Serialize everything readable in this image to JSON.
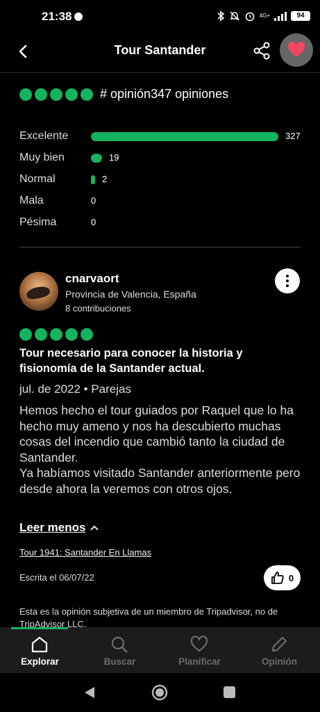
{
  "status_bar": {
    "time": "21:38",
    "network": "4G+",
    "battery": "94"
  },
  "header": {
    "title": "Tour Santander"
  },
  "summary": {
    "rating_bubbles": 5,
    "text": "# opinión347 opiniones"
  },
  "distribution": [
    {
      "label": "Excelente",
      "count": "327",
      "fraction": 1.0
    },
    {
      "label": "Muy bien",
      "count": "19",
      "fraction": 0.058
    },
    {
      "label": "Normal",
      "count": "2",
      "fraction": 0.006
    },
    {
      "label": "Mala",
      "count": "0",
      "fraction": 0
    },
    {
      "label": "Pésima",
      "count": "0",
      "fraction": 0
    }
  ],
  "review": {
    "username": "cnarvaort",
    "location": "Provincia de Valencia, España",
    "contributions": "8 contribuciones",
    "rating_bubbles": 5,
    "title": "Tour necesario para conocer la historia y fisionomía de la Santander actual.",
    "date_type": "jul. de 2022 • Parejas",
    "body": "Hemos hecho el tour guiados por Raquel que lo ha hecho muy ameno y nos ha descubierto muchas cosas del incendio que cambió tanto la ciudad de Santander.\nYa habíamos visitado Santander anteriormente pero desde ahora la veremos con otros ojos.",
    "read_less": "Leer menos",
    "tour_link": "Tour 1941: Santander En Llamas",
    "written": "Escrita el 06/07/22",
    "likes": "0",
    "disclaimer": "Esta es la opinión subjetiva de un miembro de Tripadvisor, no de TripAdvisor LLC."
  },
  "bottom_nav": [
    {
      "label": "Explorar",
      "icon": "home-icon",
      "active": true
    },
    {
      "label": "Buscar",
      "icon": "search-icon",
      "active": false
    },
    {
      "label": "Planificar",
      "icon": "heart-icon",
      "active": false
    },
    {
      "label": "Opinión",
      "icon": "pencil-icon",
      "active": false
    }
  ],
  "colors": {
    "accent": "#14b35f",
    "background": "#000000",
    "nav_background": "#1c1c1c",
    "favorite": "#f0485f"
  }
}
